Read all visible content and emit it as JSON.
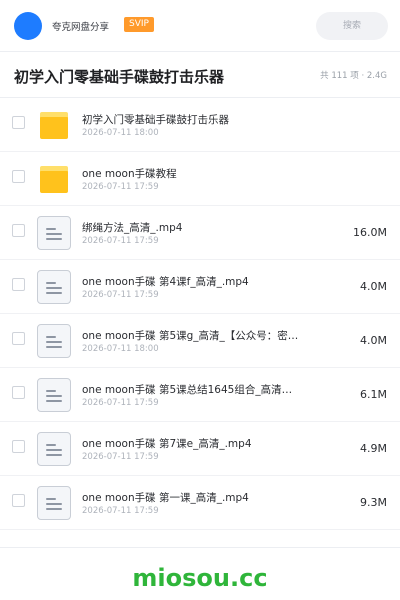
{
  "header": {
    "site_name": "夸克网盘分享",
    "badge": "SVIP",
    "search_placeholder": "搜索",
    "accent_color": "#1e7cff",
    "badge_color": "#ff9a2b"
  },
  "folder": {
    "title": "初学入门零基础手碟鼓打击乐器",
    "meta": "共 111 项 · 2.4G"
  },
  "files": [
    {
      "type": "folder",
      "icon": "folder-icon",
      "name": "初学入门零基础手碟鼓打击乐器",
      "date": "2026-07-11 18:00",
      "size": ""
    },
    {
      "type": "folder",
      "icon": "folder-icon",
      "name": "one moon手碟教程",
      "date": "2026-07-11 17:59",
      "size": ""
    },
    {
      "type": "file",
      "icon": "video-file-icon",
      "name": "绑绳方法_高清_.mp4",
      "date": "2026-07-11 17:59",
      "size": "16.0M"
    },
    {
      "type": "file",
      "icon": "video-file-icon",
      "name": "one moon手碟 第4课f_高清_.mp4",
      "date": "2026-07-11 17:59",
      "size": "4.0M"
    },
    {
      "type": "file",
      "icon": "video-file-icon",
      "name": "one moon手碟 第5课g_高清_【公众号：密…",
      "date": "2026-07-11 18:00",
      "size": "4.0M"
    },
    {
      "type": "file",
      "icon": "video-file-icon",
      "name": "one moon手碟 第5课总结1645组合_高清…",
      "date": "2026-07-11 17:59",
      "size": "6.1M"
    },
    {
      "type": "file",
      "icon": "video-file-icon",
      "name": "one moon手碟 第7课e_高清_.mp4",
      "date": "2026-07-11 17:59",
      "size": "4.9M"
    },
    {
      "type": "file",
      "icon": "video-file-icon",
      "name": "one moon手碟 第一课_高清_.mp4",
      "date": "2026-07-11 17:59",
      "size": "9.3M"
    }
  ],
  "footer": {
    "watermark": "miosou.cc",
    "watermark_color": "#2fb53a"
  }
}
